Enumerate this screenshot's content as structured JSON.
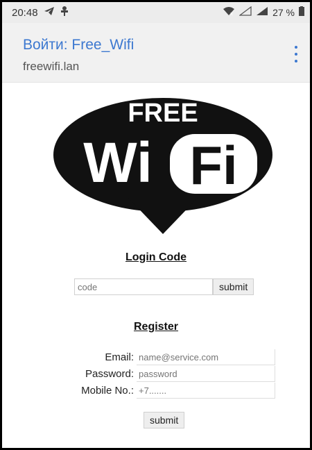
{
  "statusbar": {
    "time": "20:48",
    "battery": "27 %"
  },
  "portal": {
    "title": "Войти: Free_Wifi",
    "url": "freewifi.lan"
  },
  "logo": {
    "line1": "FREE",
    "part1": "Wi",
    "part2": "Fi"
  },
  "login": {
    "title": "Login Code",
    "code_placeholder": "code",
    "code_value": "",
    "submit_label": "submit"
  },
  "register": {
    "title": "Register",
    "email_label": "Email:",
    "email_placeholder": "name@service.com",
    "password_label": "Password:",
    "password_placeholder": "password",
    "mobile_label": "Mobile No.:",
    "mobile_placeholder": "+7.......",
    "submit_label": "submit"
  },
  "colors": {
    "accent": "#3c78d0",
    "logo": "#111111",
    "header_bg": "#f1f1f1",
    "statusbar_bg": "#ececec"
  },
  "icons": {
    "status_left": [
      "telegram-icon",
      "usb-debug-icon"
    ],
    "status_right": [
      "wifi-icon",
      "signal-icon-1",
      "signal-icon-2",
      "battery-icon"
    ],
    "header": [
      "overflow-menu-icon"
    ]
  }
}
